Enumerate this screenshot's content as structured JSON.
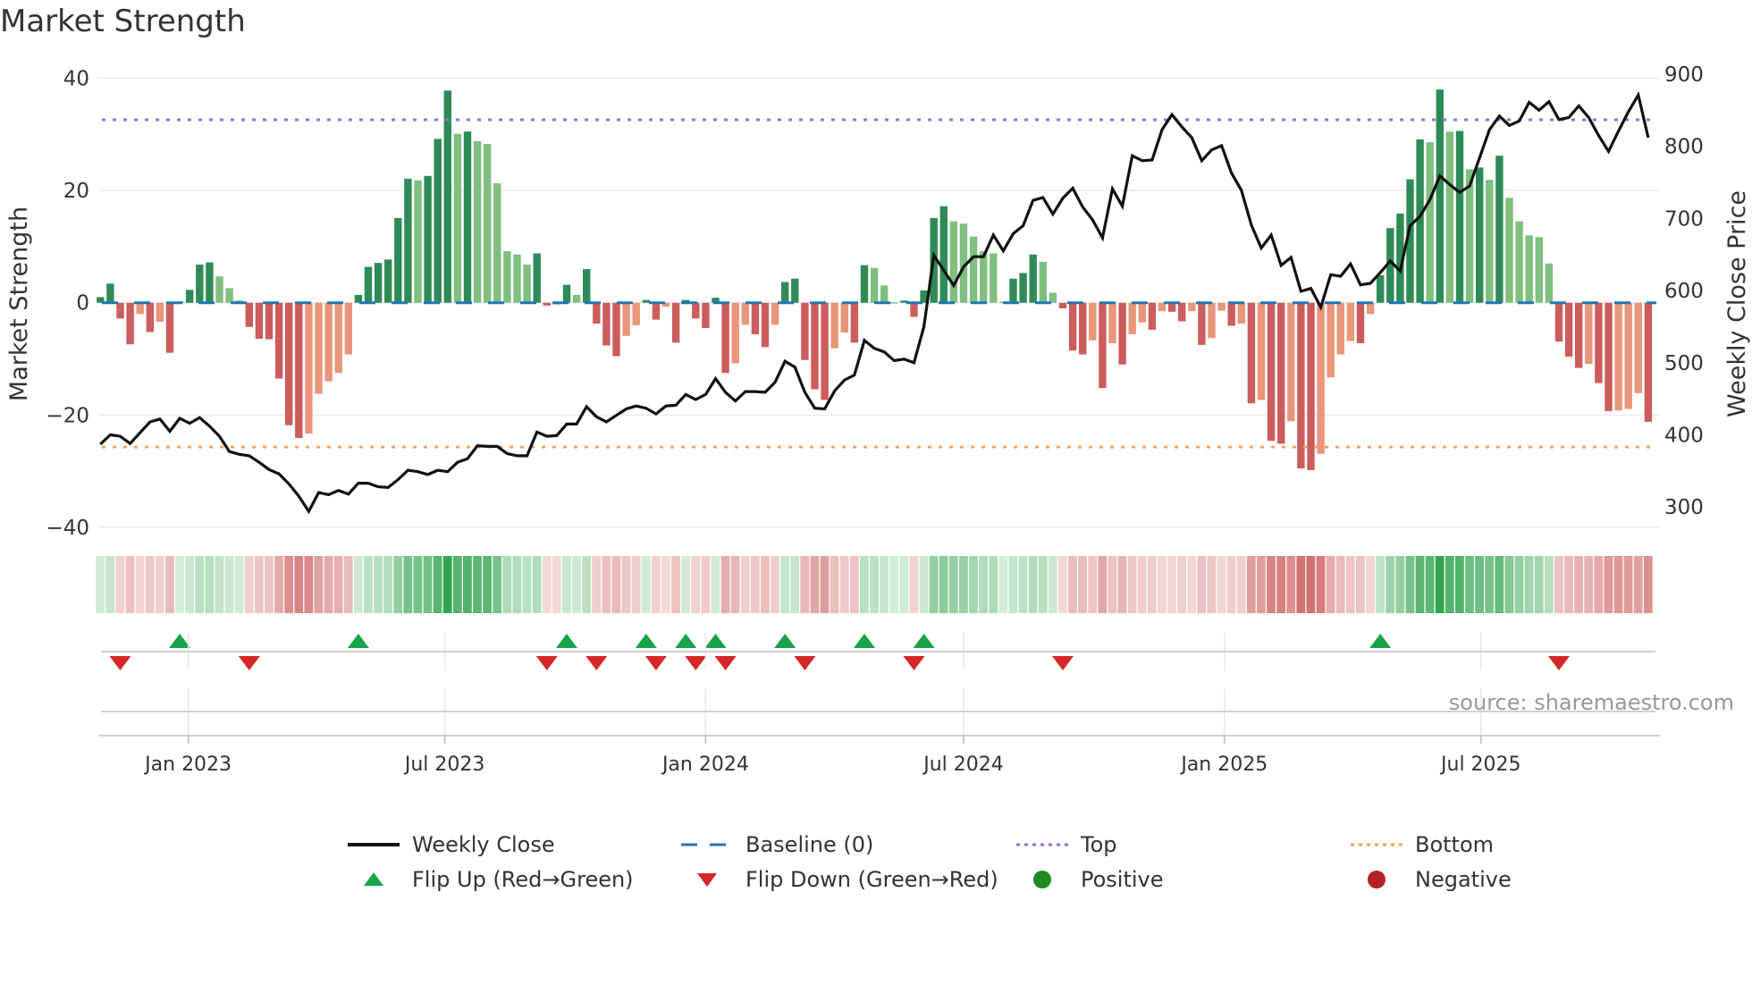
{
  "title": "Market Strength",
  "source": "source: sharemaestro.com",
  "chart_data": {
    "type": "bar",
    "title": "Market Strength",
    "xlabel": "",
    "ylabel": "Market Strength",
    "y2label": "Weekly Close Price",
    "start_date": "2022-10-31",
    "interval": "weekly",
    "ylim": [
      -41.6,
      41.2
    ],
    "y2lim": [
      259.4,
      903.7
    ],
    "yticks": [
      40,
      20,
      0,
      -20,
      -40
    ],
    "ytick_labels": [
      "40",
      "20",
      "0",
      "−20",
      "−40"
    ],
    "y2ticks": [
      900,
      800,
      700,
      600,
      500,
      400,
      300
    ],
    "y2tick_labels": [
      "900",
      "800",
      "700",
      "600",
      "500",
      "400",
      "300"
    ],
    "xticks": [
      {
        "date": "2023-01-01",
        "label": "Jan 2023"
      },
      {
        "date": "2023-07-01",
        "label": "Jul 2023"
      },
      {
        "date": "2024-01-01",
        "label": "Jan 2024"
      },
      {
        "date": "2024-07-01",
        "label": "Jul 2024"
      },
      {
        "date": "2025-01-01",
        "label": "Jan 2025"
      },
      {
        "date": "2025-07-01",
        "label": "Jul 2025"
      }
    ],
    "top_level": 32.6,
    "bottom_level": -25.7,
    "baseline": 0,
    "grid": true,
    "series": [
      {
        "name": "Market Strength",
        "axis": "left",
        "kind": "bar",
        "values": [
          1,
          3.4,
          -2.8,
          -7.4,
          -2,
          -5.2,
          -3.4,
          -8.9,
          0.2,
          2.3,
          6.8,
          7.2,
          4.7,
          2.6,
          0.4,
          -4.3,
          -6.4,
          -6.5,
          -13.5,
          -21.8,
          -24.1,
          -23.3,
          -16.2,
          -14,
          -12.5,
          -9.2,
          1.4,
          6.4,
          7.1,
          7.7,
          15.1,
          22.1,
          21.8,
          22.6,
          29.2,
          37.8,
          30.1,
          30.5,
          28.8,
          28.3,
          21.3,
          9.2,
          8.6,
          6.8,
          8.8,
          -0.5,
          -0.3,
          3.2,
          1.4,
          6.0,
          -3.7,
          -7.6,
          -9.5,
          -5.9,
          -4.0,
          0.5,
          -3.0,
          -0.7,
          -7.1,
          0.5,
          -2.8,
          -4.5,
          0.9,
          -12.5,
          -10.8,
          -3.9,
          -5.6,
          -7.9,
          -3.9,
          3.7,
          4.3,
          -10.2,
          -15.4,
          -17.3,
          -8.1,
          -5.3,
          -7.1,
          6.7,
          6.2,
          3.1,
          0.1,
          0.4,
          -2.5,
          2.2,
          15.1,
          17.2,
          14.5,
          14.1,
          11.8,
          9.2,
          8.8,
          0.2,
          4.3,
          5.3,
          8.6,
          7.3,
          1.8,
          -1.0,
          -8.5,
          -9.2,
          -6.7,
          -15.2,
          -7.2,
          -11.0,
          -5.6,
          -3.5,
          -4.8,
          -1.5,
          -1.6,
          -3.3,
          -1.5,
          -7.5,
          -6.3,
          -1.4,
          -4.1,
          -3.7,
          -17.9,
          -17.3,
          -24.6,
          -25.1,
          -21.1,
          -29.5,
          -29.8,
          -26.9,
          -13.3,
          -9.2,
          -6.8,
          -7.2,
          -2.0,
          4.9,
          13.3,
          15.9,
          22.0,
          29.1,
          28.6,
          38.0,
          30.5,
          30.6,
          23.8,
          24.1,
          21.9,
          26.2,
          18.7,
          14.5,
          12.0,
          11.7,
          7.0,
          -6.9,
          -9.6,
          -11.6,
          -10.9,
          -14.3,
          -19.3,
          -19.2,
          -18.9,
          -16.1,
          -21.2
        ]
      },
      {
        "name": "Weekly Close",
        "axis": "right",
        "kind": "line",
        "values": [
          387,
          400,
          398,
          388,
          403,
          418,
          422,
          405,
          423,
          416,
          424,
          412,
          398,
          377,
          373,
          371,
          362,
          352,
          346,
          332,
          315,
          294,
          320,
          317,
          323,
          318,
          333,
          333,
          328,
          327,
          338,
          351,
          349,
          345,
          351,
          349,
          362,
          367,
          385,
          384,
          384,
          374,
          371,
          371,
          404,
          398,
          399,
          415,
          415,
          439,
          425,
          418,
          427,
          436,
          440,
          437,
          429,
          440,
          441,
          456,
          449,
          456,
          478,
          459,
          447,
          460,
          460,
          459,
          473,
          502,
          494,
          459,
          437,
          436,
          461,
          476,
          483,
          531,
          520,
          515,
          503,
          505,
          500,
          550,
          649,
          628,
          607,
          633,
          647,
          647,
          677,
          655,
          679,
          690,
          725,
          729,
          706,
          728,
          742,
          716,
          698,
          673,
          741,
          717,
          787,
          780,
          781,
          823,
          844,
          827,
          812,
          780,
          795,
          801,
          763,
          739,
          691,
          659,
          677,
          635,
          646,
          599,
          603,
          577,
          622,
          620,
          637,
          608,
          610,
          625,
          641,
          627,
          690,
          703,
          726,
          759,
          747,
          736,
          745,
          784,
          823,
          842,
          829,
          835,
          861,
          850,
          862,
          837,
          840,
          856,
          840,
          815,
          793,
          821,
          848,
          871,
          812
        ]
      }
    ],
    "flips_up": [
      8,
      26,
      47,
      55,
      59,
      62,
      69,
      77,
      83,
      129
    ],
    "flips_down": [
      2,
      15,
      45,
      50,
      56,
      60,
      63,
      71,
      82,
      97,
      147
    ],
    "colors": {
      "strong_up": "#2e8b57",
      "weak_up": "#7fbf7f",
      "strong_down": "#cd5c5c",
      "weak_down": "#e9967a",
      "line": "#111111",
      "baseline": "#1f77b4",
      "top": "#9370db",
      "bottom": "#f4a460",
      "flip_up": "#16a34a",
      "flip_down": "#d62728",
      "positive": "#228b22",
      "negative": "#b22222"
    },
    "legend": [
      {
        "label": "Weekly Close",
        "symbol": "line"
      },
      {
        "label": "Baseline (0)",
        "symbol": "dash"
      },
      {
        "label": "Top",
        "symbol": "dot-top"
      },
      {
        "label": "Bottom",
        "symbol": "dot-bottom"
      },
      {
        "label": "Flip Up (Red→Green)",
        "symbol": "tri-up"
      },
      {
        "label": "Flip Down (Green→Red)",
        "symbol": "tri-down"
      },
      {
        "label": "Positive",
        "symbol": "dot-pos"
      },
      {
        "label": "Negative",
        "symbol": "dot-neg"
      }
    ],
    "legend_position": "bottom"
  }
}
